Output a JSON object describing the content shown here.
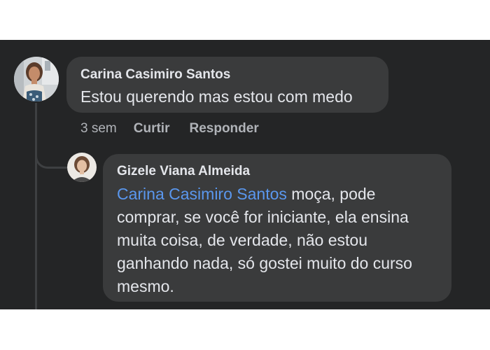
{
  "comments": [
    {
      "author": "Carina Casimiro Santos",
      "text": "Estou querendo mas estou com medo",
      "time": "3 sem",
      "actions": {
        "like": "Curtir",
        "reply": "Responder"
      }
    }
  ],
  "replies": [
    {
      "author": "Gizele Viana Almeida",
      "mention": "Carina Casimiro Santos",
      "text": " moça, pode comprar, se você for iniciante, ela ensina muita coisa, de verdade, não estou ganhando nada, só gostei muito do curso mesmo."
    }
  ],
  "colors": {
    "panel_bg": "#242526",
    "bubble_bg": "#3a3b3c",
    "text": "#e4e6eb",
    "muted": "#b0b3b8",
    "mention": "#5a97ee"
  }
}
